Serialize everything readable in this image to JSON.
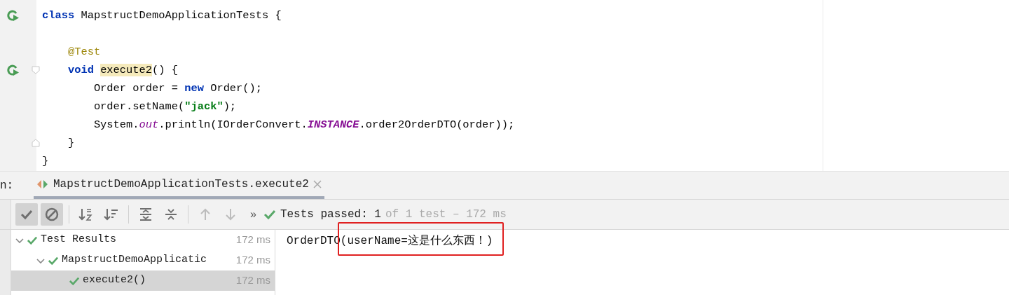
{
  "editor": {
    "lines": [
      {
        "run_marker": true,
        "fold_open": false,
        "fold_close": false,
        "tokens": [
          {
            "kind": "keyword",
            "text": "class"
          },
          {
            "kind": "plain",
            "text": " MapstructDemoApplicationTests {"
          }
        ]
      },
      {
        "run_marker": false,
        "fold_open": false,
        "fold_close": false,
        "blank_line_above": true,
        "tokens": [
          {
            "kind": "annotation",
            "text": "    @Test"
          }
        ]
      },
      {
        "run_marker": true,
        "fold_open": true,
        "fold_close": false,
        "tokens": [
          {
            "kind": "keyword",
            "text": "    void "
          },
          {
            "kind": "usage",
            "text": "execute2"
          },
          {
            "kind": "plain",
            "text": "() {"
          }
        ]
      },
      {
        "run_marker": false,
        "fold_open": false,
        "fold_close": false,
        "tokens": [
          {
            "kind": "plain",
            "text": "        Order order = "
          },
          {
            "kind": "keyword",
            "text": "new"
          },
          {
            "kind": "plain",
            "text": " Order();"
          }
        ]
      },
      {
        "run_marker": false,
        "fold_open": false,
        "fold_close": false,
        "tokens": [
          {
            "kind": "plain",
            "text": "        order.setName("
          },
          {
            "kind": "string",
            "text": "\"jack\""
          },
          {
            "kind": "plain",
            "text": ");"
          }
        ]
      },
      {
        "run_marker": false,
        "fold_open": false,
        "fold_close": false,
        "tokens": [
          {
            "kind": "plain",
            "text": "        System."
          },
          {
            "kind": "field",
            "text": "out"
          },
          {
            "kind": "plain",
            "text": ".println(IOrderConvert."
          },
          {
            "kind": "constant",
            "text": "INSTANCE"
          },
          {
            "kind": "plain",
            "text": ".order2OrderDTO(order));"
          }
        ]
      },
      {
        "run_marker": false,
        "fold_open": false,
        "fold_close": true,
        "tokens": [
          {
            "kind": "plain",
            "text": "    }"
          }
        ]
      },
      {
        "run_marker": false,
        "fold_open": false,
        "fold_close": false,
        "tokens": [
          {
            "kind": "plain",
            "text": "}"
          }
        ]
      }
    ]
  },
  "run_panel": {
    "label": "n:",
    "tabs": [
      {
        "label": "MapstructDemoApplicationTests.execute2",
        "selected": true
      }
    ]
  },
  "toolbar": [
    {
      "kind": "check",
      "selected": true,
      "disabled": false
    },
    {
      "kind": "stop",
      "selected": true,
      "disabled": false
    },
    {
      "kind": "sort-alpha",
      "selected": false,
      "disabled": false
    },
    {
      "kind": "sort-duration",
      "selected": false,
      "disabled": false
    },
    {
      "kind": "expand",
      "selected": false,
      "disabled": false
    },
    {
      "kind": "collapse",
      "selected": false,
      "disabled": false
    },
    {
      "kind": "up",
      "selected": false,
      "disabled": true
    },
    {
      "kind": "down",
      "selected": false,
      "disabled": true
    }
  ],
  "more": "»",
  "status": {
    "passed": "Tests passed: 1",
    "detail": "of 1 test – 172 ms"
  },
  "tree": [
    {
      "label": "Test Results",
      "time": "172 ms",
      "expanded": true,
      "selected": false,
      "children": [
        {
          "label": "MapstructDemoApplicatic",
          "time": "172 ms",
          "expanded": true,
          "selected": false,
          "children": [
            {
              "label": "execute2()",
              "time": "172 ms",
              "selected": true
            }
          ]
        }
      ]
    }
  ],
  "console": {
    "text": "OrderDTO(userName=这是什么东西！)"
  }
}
